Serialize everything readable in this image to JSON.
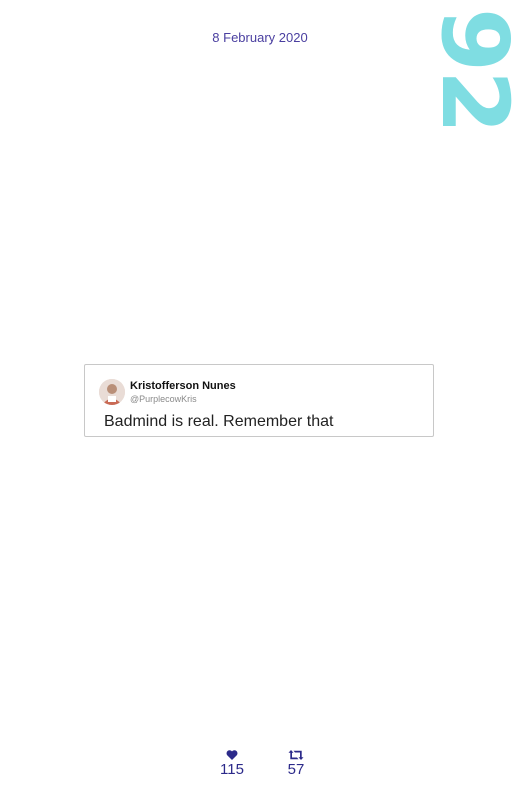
{
  "date": "8 February 2020",
  "page_number": "92",
  "tweet": {
    "author_name": "Kristofferson Nunes",
    "author_handle": "@PurplecowKris",
    "text": "Badmind is real. Remember that"
  },
  "stats": {
    "likes": "115",
    "retweets": "57",
    "likes_icon": "heart-icon",
    "retweets_icon": "retweet-icon"
  },
  "colors": {
    "date": "#4a3fa0",
    "page_number": "#7fdde2",
    "stats": "#2c2a8a"
  }
}
